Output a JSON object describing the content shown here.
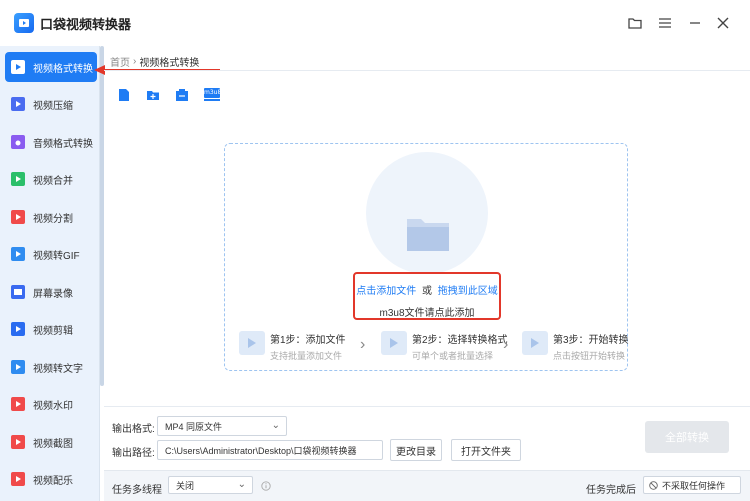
{
  "app": {
    "title": "口袋视频转换器"
  },
  "sidebar": {
    "items": [
      {
        "label": "视频格式转换",
        "color": "#ffffff"
      },
      {
        "label": "视频压缩",
        "color": "#4a6cf0"
      },
      {
        "label": "音频格式转换",
        "color": "#8a5cf0"
      },
      {
        "label": "视频合并",
        "color": "#2bbf6a"
      },
      {
        "label": "视频分割",
        "color": "#f04a4a"
      },
      {
        "label": "视频转GIF",
        "color": "#2f8cf0"
      },
      {
        "label": "屏幕录像",
        "color": "#3a6af0"
      },
      {
        "label": "视频剪辑",
        "color": "#2a6cf0"
      },
      {
        "label": "视频转文字",
        "color": "#2f8cf0"
      },
      {
        "label": "视频水印",
        "color": "#f04a4a"
      },
      {
        "label": "视频截图",
        "color": "#f04a4a"
      },
      {
        "label": "视频配乐",
        "color": "#f04a4a"
      }
    ]
  },
  "breadcrumb": {
    "home": "首页",
    "separator": "›",
    "current": "视频格式转换"
  },
  "toolbar": {
    "m3u8_label": "m3u8"
  },
  "drop": {
    "add_file": "点击添加文件",
    "or": "或",
    "drag_here": "拖拽到此区域",
    "m3u8_hint": "m3u8文件请点此添加",
    "steps": [
      {
        "title": "第1步：添加文件",
        "sub": "支持批量添加文件"
      },
      {
        "title": "第2步：选择转换格式",
        "sub": "可单个或者批量选择"
      },
      {
        "title": "第3步：开始转换",
        "sub": "点击按钮开始转换"
      }
    ]
  },
  "output": {
    "format_label": "输出格式:",
    "format_value": "MP4  同原文件",
    "path_label": "输出路径:",
    "path_value": "C:\\Users\\Administrator\\Desktop\\口袋视频转换器",
    "change_dir": "更改目录",
    "open_folder": "打开文件夹",
    "convert_all": "全部转换"
  },
  "status": {
    "multithread_label": "任务多线程",
    "multithread_value": "关闭",
    "after_done_label": "任务完成后",
    "after_done_value": "不采取任何操作"
  },
  "colors": {
    "accent": "#1f7cf4",
    "annotation": "#e2372a"
  }
}
